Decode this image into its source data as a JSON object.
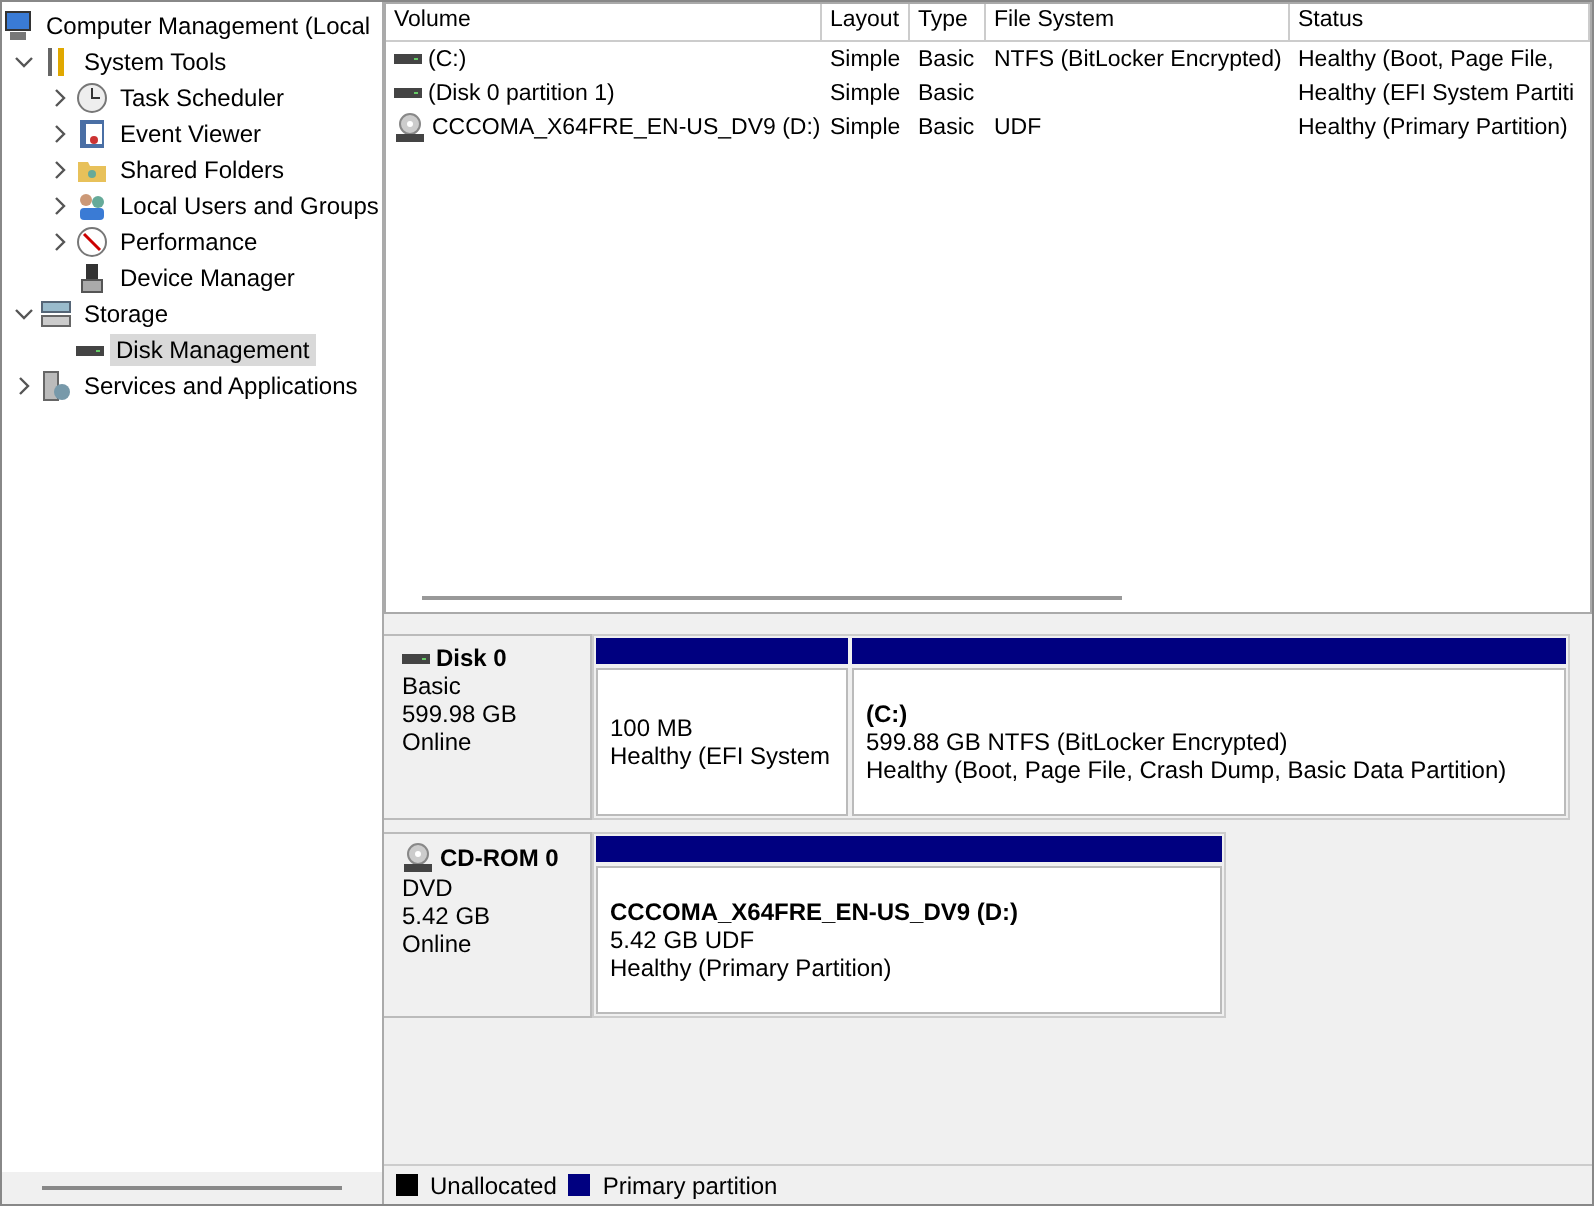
{
  "tree": {
    "label": "Computer Management (Local",
    "children": [
      {
        "label": "System Tools",
        "expanded": true,
        "selected": false,
        "children": [
          {
            "label": "Task Scheduler",
            "expanded": false,
            "selected": false
          },
          {
            "label": "Event Viewer",
            "expanded": false,
            "selected": false
          },
          {
            "label": "Shared Folders",
            "expanded": false,
            "selected": false
          },
          {
            "label": "Local Users and Groups",
            "expanded": false,
            "selected": false
          },
          {
            "label": "Performance",
            "expanded": false,
            "selected": false
          },
          {
            "label": "Device Manager",
            "selected": false
          }
        ]
      },
      {
        "label": "Storage",
        "expanded": true,
        "selected": false,
        "children": [
          {
            "label": "Disk Management",
            "selected": true
          }
        ]
      },
      {
        "label": "Services and Applications",
        "expanded": false,
        "selected": false
      }
    ]
  },
  "table": {
    "columns": [
      "Volume",
      "Layout",
      "Type",
      "File System",
      "Status"
    ],
    "rows": [
      {
        "kind": "disk",
        "cells": [
          "(C:)",
          "Simple",
          "Basic",
          "NTFS (BitLocker Encrypted)",
          "Healthy (Boot, Page File,"
        ]
      },
      {
        "kind": "disk",
        "cells": [
          "(Disk 0 partition 1)",
          "Simple",
          "Basic",
          "",
          "Healthy (EFI System Partiti"
        ]
      },
      {
        "kind": "cdrom",
        "cells": [
          "CCCOMA_X64FRE_EN-US_DV9 (D:)",
          "Simple",
          "Basic",
          "UDF",
          "Healthy (Primary Partition)"
        ]
      }
    ]
  },
  "disks": [
    {
      "kind": "disk",
      "name": "Disk 0",
      "type": "Basic",
      "size": "599.98 GB",
      "status": "Online",
      "partitions": [
        {
          "kind": "primary",
          "size": "100 MB",
          "status": "Healthy (EFI System"
        },
        {
          "kind": "primary",
          "label": "(C:)",
          "size": "599.88 GB NTFS (BitLocker Encrypted)",
          "status": "Healthy (Boot, Page File, Crash Dump, Basic Data Partition)"
        }
      ]
    },
    {
      "kind": "cdrom",
      "name": "CD-ROM 0",
      "type": "DVD",
      "size": "5.42 GB",
      "status": "Online",
      "partitions": [
        {
          "kind": "primary",
          "label": "CCCOMA_X64FRE_EN-US_DV9  (D:)",
          "size": "5.42 GB UDF",
          "status": "Healthy (Primary Partition)"
        }
      ]
    }
  ],
  "legend": [
    {
      "label": "Unallocated",
      "color": "#000000"
    },
    {
      "label": "Primary partition",
      "color": "#000080"
    }
  ]
}
